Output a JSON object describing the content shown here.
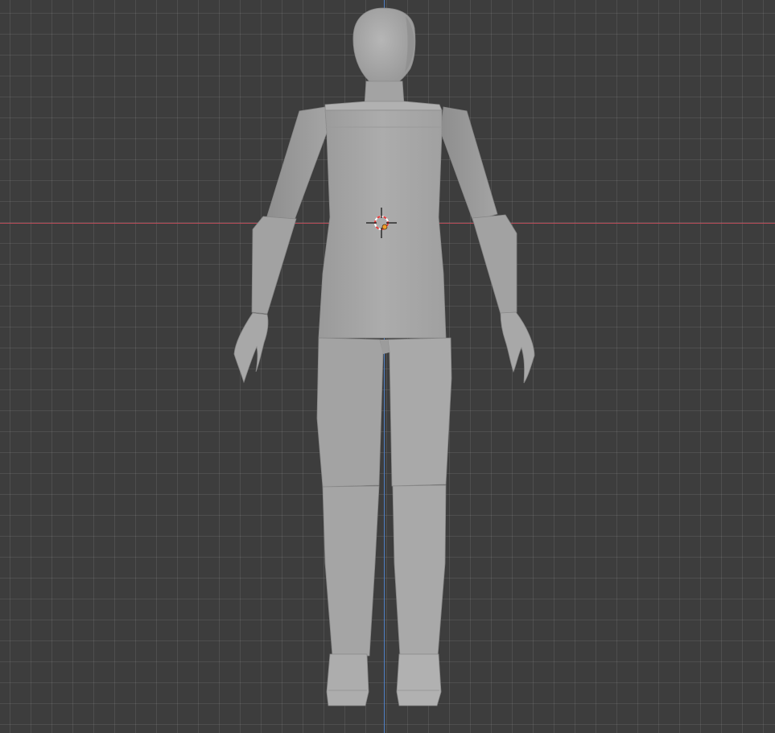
{
  "viewport": {
    "mode": "3d-viewport",
    "background_color": "#3d3d3d",
    "grid_color": "#4a4a4a",
    "x_axis_color": "#b84b58",
    "y_axis_color": "#4f7fc4"
  },
  "object": {
    "kind": "humanoid-mannequin",
    "material_color": "#a6a6a6",
    "view": "front-orthographic"
  },
  "cursor": {
    "icon": "3d-cursor-icon",
    "colors": [
      "#e53b3b",
      "#ffffff",
      "#1a1a1a"
    ]
  },
  "origin": {
    "icon": "object-origin-icon",
    "color": "#f29f2a"
  }
}
